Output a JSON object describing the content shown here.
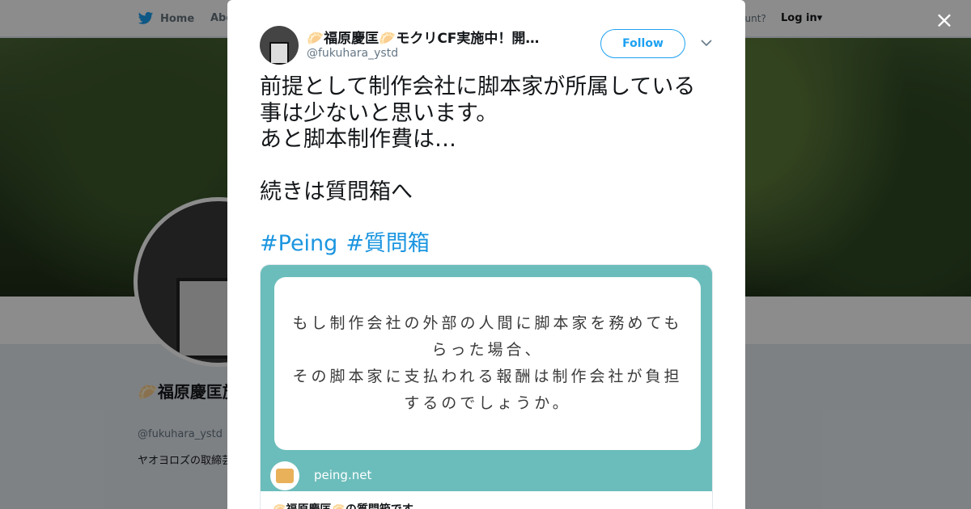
{
  "background": {
    "nav": {
      "home_label": "Home",
      "about_label": "Abo",
      "account_prompt": "ccount?",
      "login_label": "Log in"
    },
    "profile": {
      "name": "🥟福原慶匡施中！開拓",
      "handle": "@fukuhara_ystd",
      "bio": "ヤオヨロズの取締芸能事務所、声優課程所属。 エンタする事が仕事です"
    }
  },
  "modal": {
    "close_label": "×",
    "author": {
      "name": "🥟福原慶匡🥟モクリCF実施中！開…",
      "handle": "@fukuhara_ystd"
    },
    "follow_label": "Follow",
    "tweet_lines": [
      "前提として制作会社に脚本家が所属している",
      "事は少ないと思います。",
      "あと脚本制作費は…"
    ],
    "tweet_continue": "続きは質問箱へ",
    "hashtags": [
      "#Peing",
      "#質問箱"
    ],
    "card": {
      "question_lines": [
        "もし制作会社の外部の人間に脚本家を務めても",
        "らった場合、",
        "その脚本家に支払われる報酬は制作会社が負担",
        "するのでしょうか。"
      ],
      "site": "peing.net",
      "title": "🥟福原慶匡🥟の質問箱です"
    }
  },
  "colors": {
    "accent": "#1da1f2",
    "hashtag": "#1b95e0",
    "card_bg": "#6bbdbb"
  }
}
